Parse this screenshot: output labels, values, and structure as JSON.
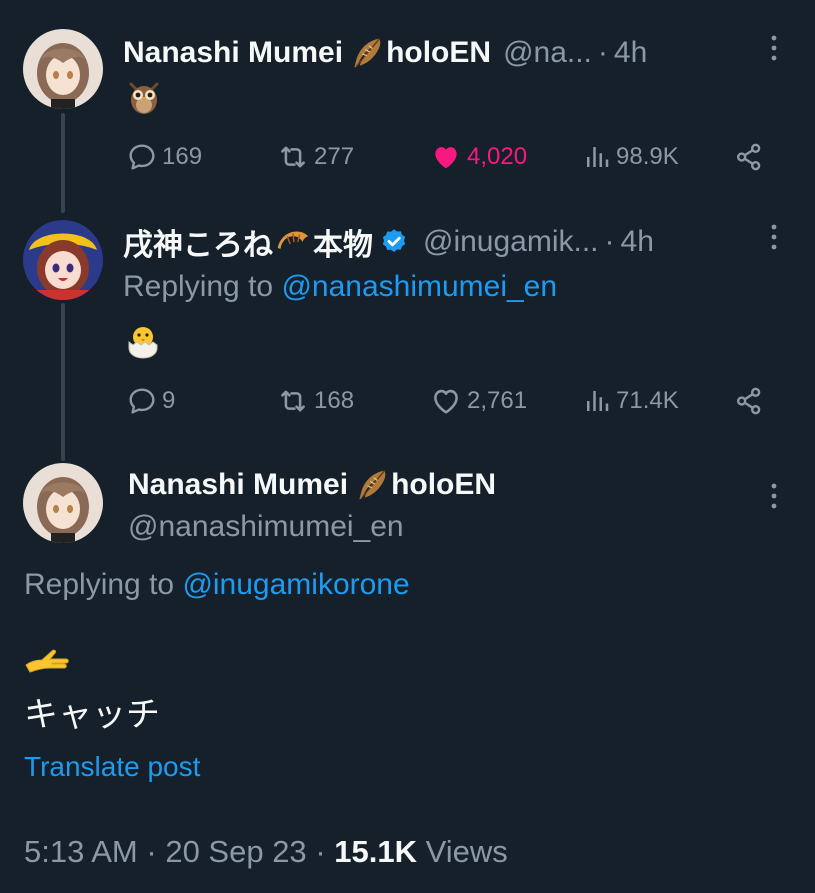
{
  "tweet1": {
    "name": "Nanashi Mumei",
    "org": "holoEN",
    "handle": "@na...",
    "separator": "·",
    "time": "4h",
    "replies": "169",
    "retweets": "277",
    "likes": "4,020",
    "views": "98.9K",
    "liked": true
  },
  "tweet2": {
    "name": "戌神ころね",
    "name_suffix": "本物",
    "handle": "@inugamik...",
    "separator": "·",
    "time": "4h",
    "replying_prefix": "Replying to",
    "replying_handle": "@nanashimumei_en",
    "replies": "9",
    "retweets": "168",
    "likes": "2,761",
    "views": "71.4K",
    "verified": true
  },
  "main_tweet": {
    "name": "Nanashi Mumei",
    "org": "holoEN",
    "handle": "@nanashimumei_en",
    "replying_prefix": "Replying to",
    "replying_handle": "@inugamikorone",
    "text": "キャッチ",
    "translate_label": "Translate post",
    "time": "5:13 AM",
    "date": "20 Sep 23",
    "separator": "·",
    "views_count": "15.1K",
    "views_label": "Views"
  },
  "icons": {
    "reply": "reply-icon",
    "retweet": "retweet-icon",
    "like": "heart-icon",
    "views": "views-icon",
    "share": "share-icon",
    "more": "more-icon",
    "verified": "verified-badge-icon"
  },
  "colors": {
    "background": "#15202b",
    "accent": "#1d9bf0",
    "like": "#f91880",
    "muted": "#8b98a5",
    "text": "#f7f9f9"
  }
}
